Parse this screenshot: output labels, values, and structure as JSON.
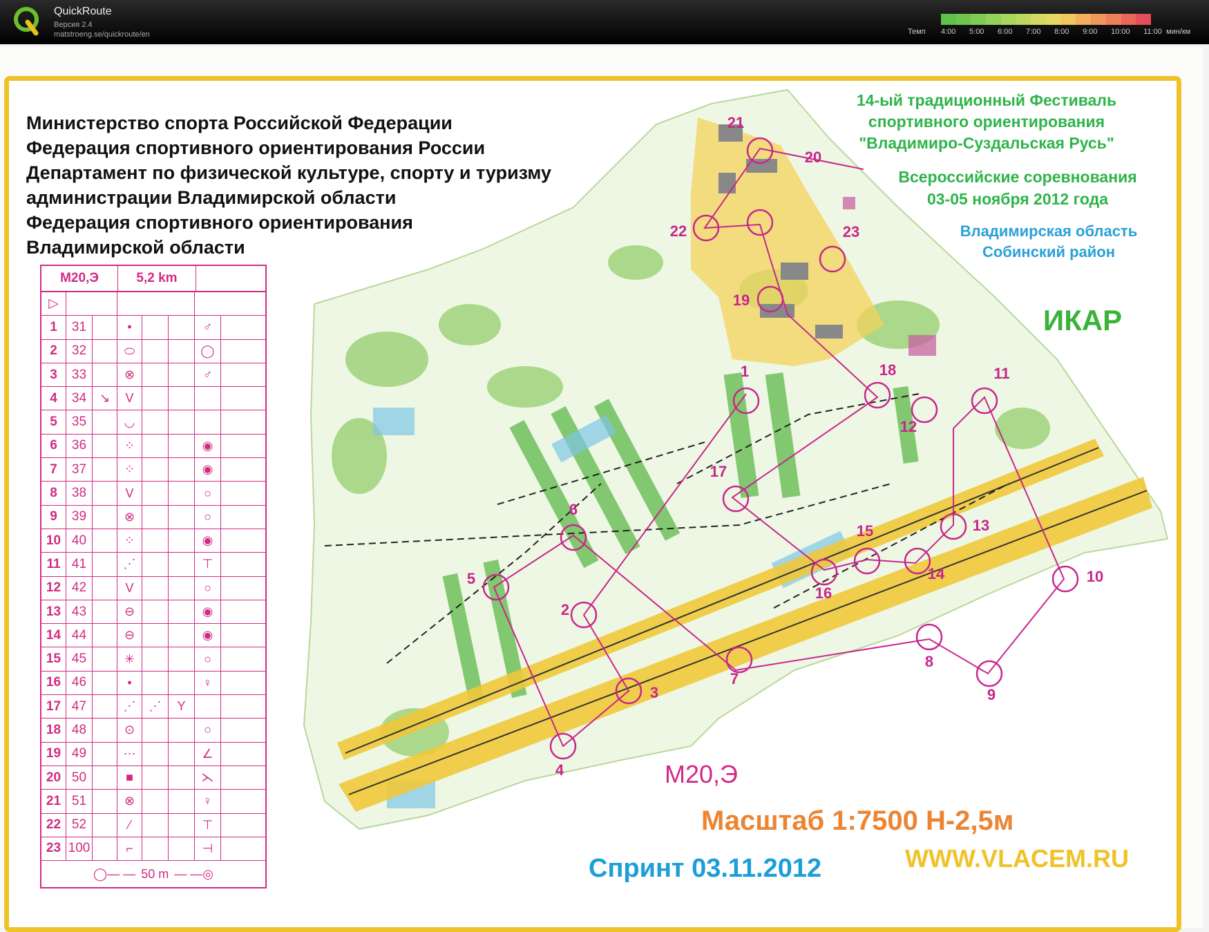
{
  "app": {
    "name": "QuickRoute",
    "version": "Версия 2.4",
    "url": "matstroeng.se/quickroute/en"
  },
  "pace_legend": {
    "label": "Темп",
    "ticks": [
      "4:00",
      "5:00",
      "6:00",
      "7:00",
      "8:00",
      "9:00",
      "10:00",
      "11:00"
    ],
    "unit": "мин/км",
    "colors": [
      "#5fc04a",
      "#6ec44e",
      "#7fcb54",
      "#93d15a",
      "#a7d65e",
      "#bcd760",
      "#d2d862",
      "#e6d664",
      "#f0c660",
      "#f0ae5e",
      "#ef965c",
      "#ec7e5a",
      "#e9665a",
      "#e34e5a"
    ]
  },
  "header_left": [
    "Министерство спорта Российской Федерации",
    "Федерация спортивного ориентирования России",
    "Департамент по физической культуре, спорту и туризму",
    "администрации Владимирской области",
    "Федерация спортивного ориентирования",
    "Владимирской области"
  ],
  "festival": [
    "14-ый традиционный Фестиваль",
    "спортивного ориентирования",
    "\"Владимиро-Суздальская Русь\""
  ],
  "competition": [
    "Всероссийские соревнования",
    "03-05 ноября 2012 года"
  ],
  "region": [
    "Владимирская область",
    "Собинский район"
  ],
  "club": "ИКАР",
  "course_name": "М20,Э",
  "scale_text": "Масштаб 1:7500  Н-2,5м",
  "sprint_text": "Спринт 03.11.2012",
  "website": "WWW.VLACEM.RU",
  "description_sheet": {
    "class": "М20,Э",
    "length": "5,2 km",
    "rows": [
      {
        "n": "1",
        "code": "31",
        "s1": "",
        "feat": "•",
        "s2": "",
        "s3": "",
        "s4": "♂"
      },
      {
        "n": "2",
        "code": "32",
        "s1": "",
        "feat": "⬭",
        "s2": "",
        "s3": "",
        "s4": "◯"
      },
      {
        "n": "3",
        "code": "33",
        "s1": "",
        "feat": "⊗",
        "s2": "",
        "s3": "",
        "s4": "♂"
      },
      {
        "n": "4",
        "code": "34",
        "s1": "↘",
        "feat": "V",
        "s2": "",
        "s3": "",
        "s4": ""
      },
      {
        "n": "5",
        "code": "35",
        "s1": "",
        "feat": "◡",
        "s2": "",
        "s3": "",
        "s4": ""
      },
      {
        "n": "6",
        "code": "36",
        "s1": "",
        "feat": "⁘",
        "s2": "",
        "s3": "",
        "s4": "◉"
      },
      {
        "n": "7",
        "code": "37",
        "s1": "",
        "feat": "⁘",
        "s2": "",
        "s3": "",
        "s4": "◉"
      },
      {
        "n": "8",
        "code": "38",
        "s1": "",
        "feat": "V",
        "s2": "",
        "s3": "",
        "s4": "○"
      },
      {
        "n": "9",
        "code": "39",
        "s1": "",
        "feat": "⊗",
        "s2": "",
        "s3": "",
        "s4": "○"
      },
      {
        "n": "10",
        "code": "40",
        "s1": "",
        "feat": "⁘",
        "s2": "",
        "s3": "",
        "s4": "◉"
      },
      {
        "n": "11",
        "code": "41",
        "s1": "",
        "feat": "⋰",
        "s2": "",
        "s3": "",
        "s4": "⊤"
      },
      {
        "n": "12",
        "code": "42",
        "s1": "",
        "feat": "V",
        "s2": "",
        "s3": "",
        "s4": "○"
      },
      {
        "n": "13",
        "code": "43",
        "s1": "",
        "feat": "⊖",
        "s2": "",
        "s3": "",
        "s4": "◉"
      },
      {
        "n": "14",
        "code": "44",
        "s1": "",
        "feat": "⊖",
        "s2": "",
        "s3": "",
        "s4": "◉"
      },
      {
        "n": "15",
        "code": "45",
        "s1": "",
        "feat": "✳",
        "s2": "",
        "s3": "",
        "s4": "○"
      },
      {
        "n": "16",
        "code": "46",
        "s1": "",
        "feat": "•",
        "s2": "",
        "s3": "",
        "s4": "♀"
      },
      {
        "n": "17",
        "code": "47",
        "s1": "",
        "feat": "⋰",
        "s2": "⋰",
        "s3": "Y",
        "s4": ""
      },
      {
        "n": "18",
        "code": "48",
        "s1": "",
        "feat": "⊙",
        "s2": "",
        "s3": "",
        "s4": "○"
      },
      {
        "n": "19",
        "code": "49",
        "s1": "",
        "feat": "⋯",
        "s2": "",
        "s3": "",
        "s4": "∠"
      },
      {
        "n": "20",
        "code": "50",
        "s1": "",
        "feat": "■",
        "s2": "",
        "s3": "",
        "s4": "⋋"
      },
      {
        "n": "21",
        "code": "51",
        "s1": "",
        "feat": "⊗",
        "s2": "",
        "s3": "",
        "s4": "♀"
      },
      {
        "n": "22",
        "code": "52",
        "s1": "",
        "feat": "⁄",
        "s2": "",
        "s3": "",
        "s4": "⊤"
      },
      {
        "n": "23",
        "code": "100",
        "s1": "",
        "feat": "⌐",
        "s2": "",
        "s3": "",
        "s4": "⊣"
      }
    ],
    "finish": "50 m"
  },
  "controls": [
    {
      "label": "1"
    },
    {
      "label": "2"
    },
    {
      "label": "3"
    },
    {
      "label": "4"
    },
    {
      "label": "5"
    },
    {
      "label": "6"
    },
    {
      "label": "7"
    },
    {
      "label": "8"
    },
    {
      "label": "9"
    },
    {
      "label": "10"
    },
    {
      "label": "11"
    },
    {
      "label": "12"
    },
    {
      "label": "13"
    },
    {
      "label": "14"
    },
    {
      "label": "15"
    },
    {
      "label": "16"
    },
    {
      "label": "17"
    },
    {
      "label": "18"
    },
    {
      "label": "19"
    },
    {
      "label": "20"
    },
    {
      "label": "21"
    },
    {
      "label": "22"
    },
    {
      "label": "23"
    }
  ]
}
